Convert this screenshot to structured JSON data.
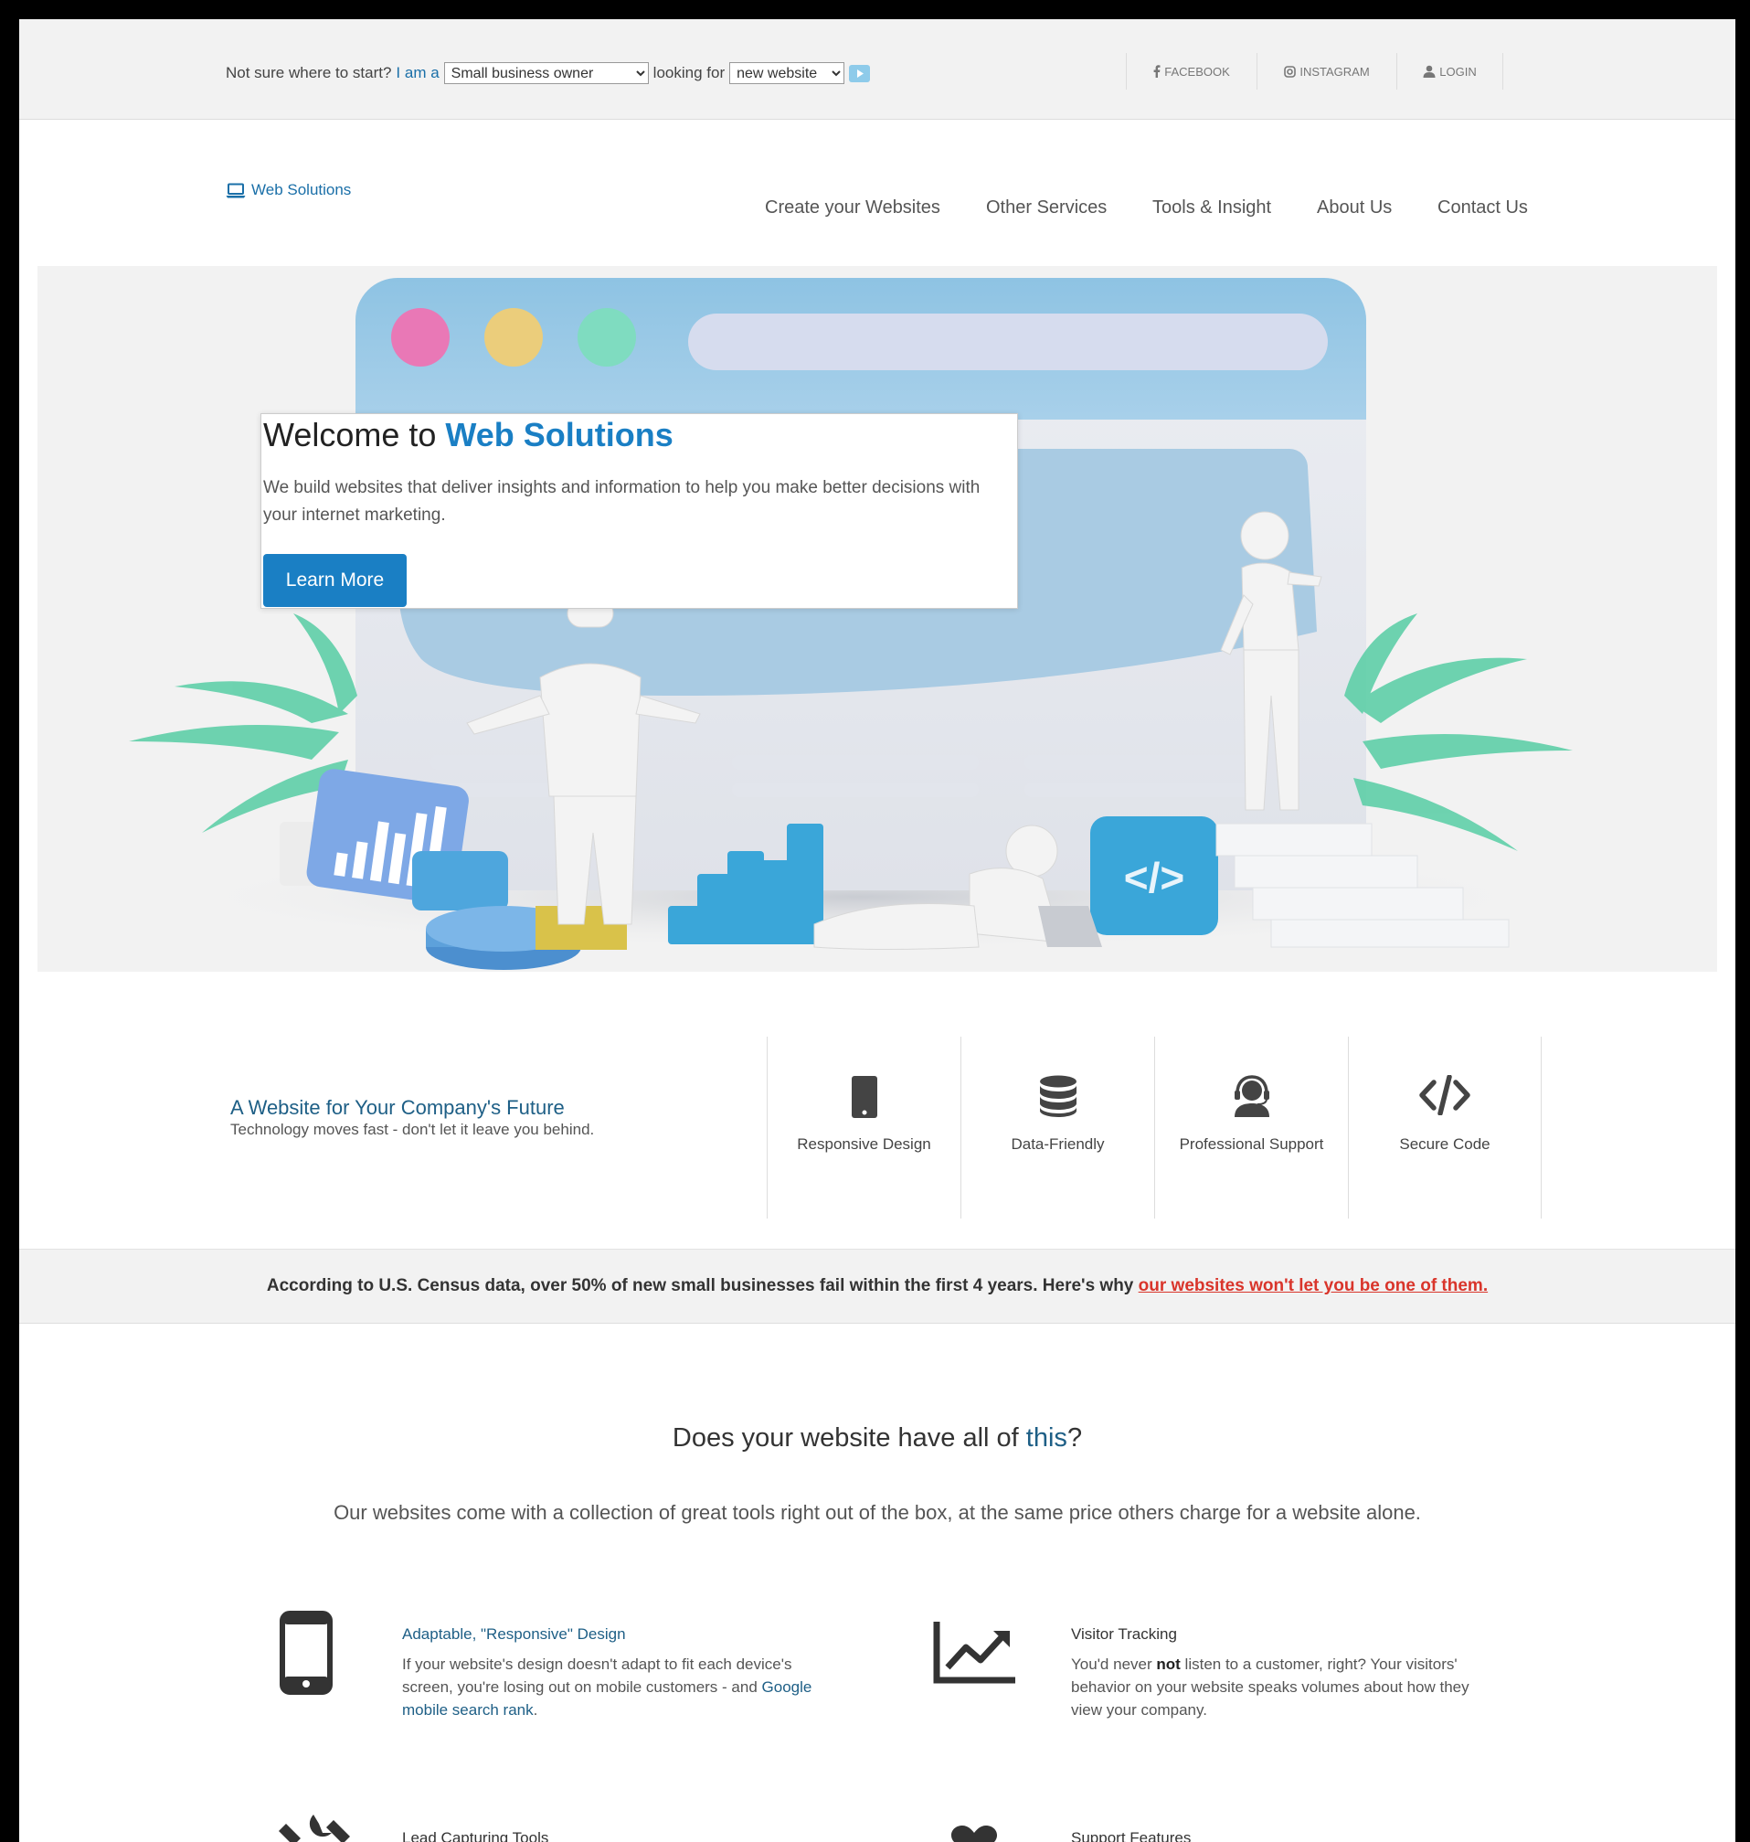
{
  "topbar": {
    "finder_prefix": "Not sure where to start?",
    "finder_i_am": "I am a",
    "role_selected": "Small business owner",
    "finder_looking": "looking for",
    "need_selected": "new website",
    "social": {
      "facebook": "FACEBOOK",
      "instagram": "INSTAGRAM",
      "login": "LOGIN"
    }
  },
  "header": {
    "logo": "Web Solutions",
    "nav": [
      "Create your Websites",
      "Other Services",
      "Tools & Insight",
      "About Us",
      "Contact Us"
    ]
  },
  "hero": {
    "title_prefix": "Welcome to",
    "title_highlight": "Web Solutions",
    "body": "We build websites that deliver insights and information to help you make better decisions with your internet marketing.",
    "button": "Learn More"
  },
  "features": {
    "title": "A Website for Your Company's Future",
    "subtitle": "Technology moves fast - don't let it leave you behind.",
    "items": [
      {
        "label": "Responsive Design",
        "icon": "mobile-icon"
      },
      {
        "label": "Data-Friendly",
        "icon": "database-icon"
      },
      {
        "label": "Professional Support",
        "icon": "headset-icon"
      },
      {
        "label": "Secure Code",
        "icon": "code-icon"
      }
    ]
  },
  "census": {
    "text": "According to U.S. Census data, over 50% of new small businesses fail within the first 4 years. Here's why",
    "link": "our websites won't let you be one of them."
  },
  "tools_section": {
    "title_prefix": "Does your website have all of",
    "title_highlight": "this",
    "title_suffix": "?",
    "subtitle": "Our websites come with a collection of great tools right out of the box, at the same price others charge for a website alone.",
    "tools": [
      {
        "title": "Adaptable, \"Responsive\" Design",
        "body": "If your website's design doesn't adapt to fit each device's screen, you're losing out on mobile customers - and",
        "link": "Google mobile search rank",
        "body_end": ".",
        "icon": "mobile-phone-icon"
      },
      {
        "title": "Visitor Tracking",
        "body_before": "You'd never",
        "body_bold": "not",
        "body_after": "listen to a customer, right? Your visitors' behavior on your website speaks volumes about how they view your company.",
        "icon": "line-chart-icon"
      },
      {
        "title": "Lead Capturing Tools",
        "icon": "tools-icon"
      },
      {
        "title": "Support Features",
        "icon": "heart-icon"
      }
    ]
  },
  "colors": {
    "accent": "#1a7fc4",
    "dark_accent": "#1e5f86",
    "link_red": "#d9352b",
    "band": "#f2f2f2"
  }
}
